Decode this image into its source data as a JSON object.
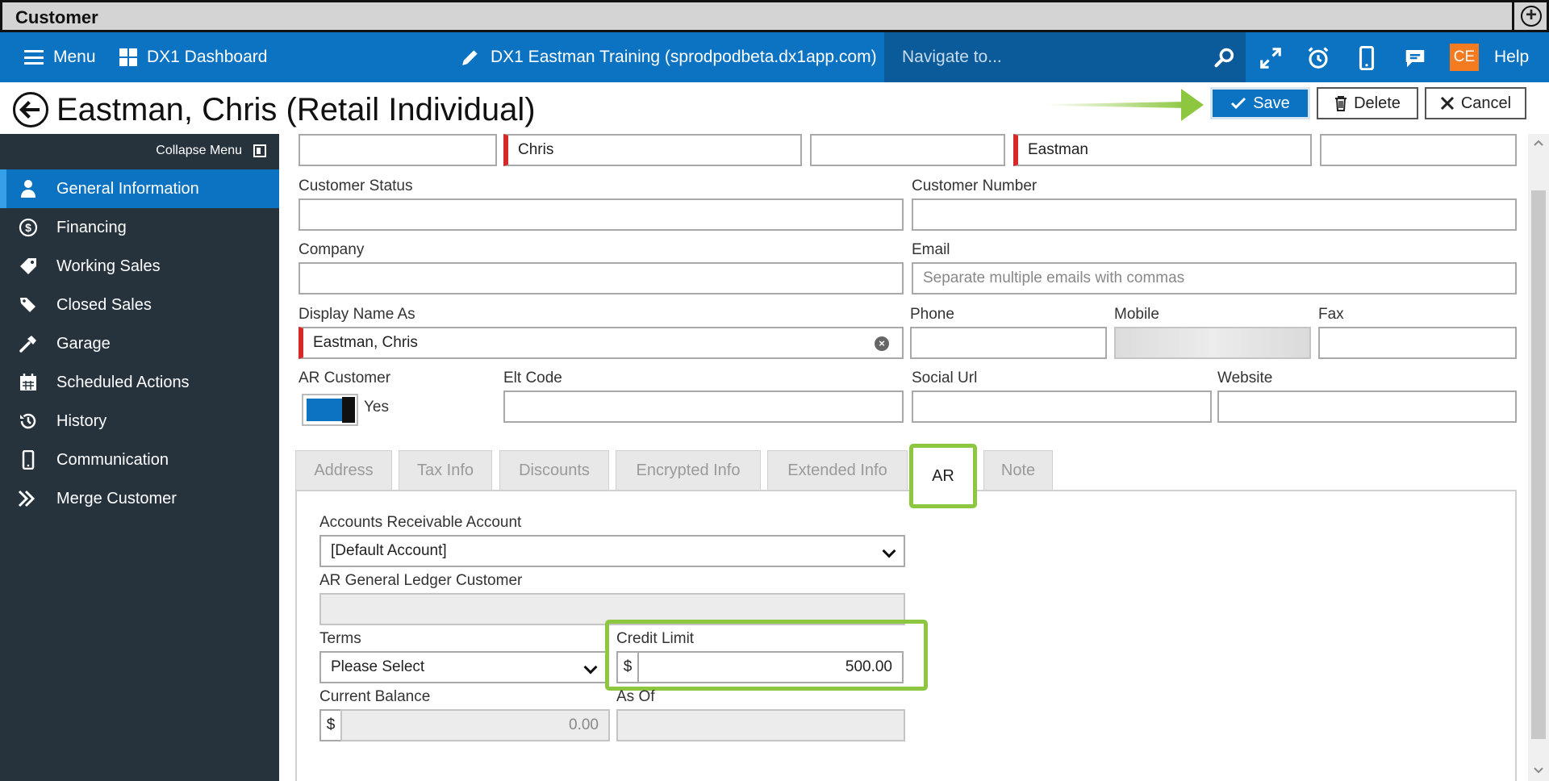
{
  "window": {
    "title": "Customer"
  },
  "topbar": {
    "menu_label": "Menu",
    "dashboard_label": "DX1 Dashboard",
    "site_label": "DX1 Eastman Training (sprodpodbeta.dx1app.com)",
    "navigate_placeholder": "Navigate to...",
    "user_initials": "CE",
    "help_label": "Help"
  },
  "header": {
    "title": "Eastman, Chris (Retail Individual)",
    "save_label": "Save",
    "delete_label": "Delete",
    "cancel_label": "Cancel"
  },
  "sidebar": {
    "collapse_label": "Collapse Menu",
    "items": [
      {
        "label": "General Information",
        "icon": "person-icon",
        "active": true
      },
      {
        "label": "Financing",
        "icon": "dollar-icon"
      },
      {
        "label": "Working Sales",
        "icon": "tag-icon"
      },
      {
        "label": "Closed Sales",
        "icon": "tags-icon"
      },
      {
        "label": "Garage",
        "icon": "hammer-icon"
      },
      {
        "label": "Scheduled Actions",
        "icon": "calendar-icon"
      },
      {
        "label": "History",
        "icon": "history-icon"
      },
      {
        "label": "Communication",
        "icon": "phone-icon"
      },
      {
        "label": "Merge Customer",
        "icon": "merge-icon"
      }
    ]
  },
  "form": {
    "name_row": {
      "prefix": "",
      "first_name": "Chris",
      "middle": "",
      "last_name": "Eastman",
      "suffix": ""
    },
    "customer_status_label": "Customer Status",
    "customer_status": "",
    "customer_number_label": "Customer Number",
    "customer_number": "",
    "company_label": "Company",
    "company": "",
    "email_label": "Email",
    "email_placeholder": "Separate multiple emails with commas",
    "display_name_label": "Display Name As",
    "display_name": "Eastman, Chris",
    "phone_label": "Phone",
    "mobile_label": "Mobile",
    "fax_label": "Fax",
    "ar_customer_label": "AR Customer",
    "ar_customer_value": "Yes",
    "elt_code_label": "Elt Code",
    "social_url_label": "Social Url",
    "website_label": "Website"
  },
  "tabs": [
    {
      "label": "Address"
    },
    {
      "label": "Tax Info"
    },
    {
      "label": "Discounts"
    },
    {
      "label": "Encrypted Info"
    },
    {
      "label": "Extended Info"
    },
    {
      "label": "AR",
      "active": true
    },
    {
      "label": "Note"
    }
  ],
  "ar_panel": {
    "account_label": "Accounts Receivable Account",
    "account_value": "[Default Account]",
    "gl_customer_label": "AR General Ledger Customer",
    "gl_customer_value": "",
    "terms_label": "Terms",
    "terms_value": "Please Select",
    "credit_limit_label": "Credit Limit",
    "credit_limit_value": "500.00",
    "current_balance_label": "Current Balance",
    "current_balance_value": "0.00",
    "as_of_label": "As Of",
    "as_of_value": "",
    "currency_symbol": "$"
  },
  "colors": {
    "brand_blue": "#0c73c2",
    "sidebar_bg": "#26333d",
    "highlight_green": "#8dc73f",
    "required_red": "#d62a2a",
    "avatar_orange": "#f47b20"
  }
}
